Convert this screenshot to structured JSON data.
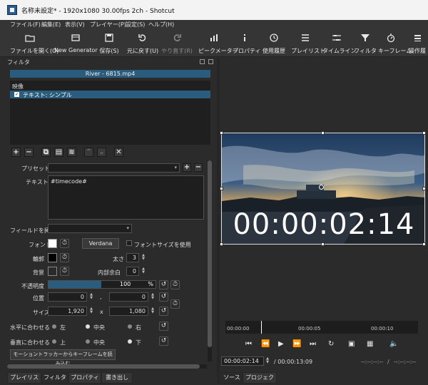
{
  "window": {
    "title": "名称未設定* - 1920x1080 30.00fps 2ch - Shotcut"
  },
  "menu": [
    "ファイル(F)",
    "編集(E)",
    "表示(V)",
    "プレイヤー(P)",
    "設定(S)",
    "ヘルプ(H)"
  ],
  "toolbar": [
    {
      "label": "ファイルを開く(O)",
      "icon": "folder-icon"
    },
    {
      "label": "New Generator",
      "icon": "film-icon"
    },
    {
      "label": "保存(S)",
      "icon": "save-icon"
    },
    {
      "label": "元に戻す(U)",
      "icon": "undo-icon"
    },
    {
      "label": "やり直す(R)",
      "icon": "redo-icon"
    },
    {
      "label": "ピークメーター",
      "icon": "meter-icon"
    },
    {
      "label": "プロパティ",
      "icon": "info-icon"
    },
    {
      "label": "使用履歴",
      "icon": "clock-icon"
    },
    {
      "label": "プレイリスト",
      "icon": "list-icon"
    },
    {
      "label": "タイムライン",
      "icon": "timeline-icon"
    },
    {
      "label": "フィルタ",
      "icon": "funnel-icon"
    },
    {
      "label": "キーフレーム",
      "icon": "stopwatch-icon"
    },
    {
      "label": "操作履",
      "icon": "history-icon"
    }
  ],
  "filters": {
    "panel_title": "フィルタ",
    "clip_name": "River - 6815.mp4",
    "category": "映像",
    "item": "テキスト: シンプル",
    "preset_label": "プリセット",
    "text_label": "テキスト",
    "text_value": "#timecode#",
    "insert_field_label": "フィールドを挿入",
    "font_label": "フォント",
    "font_button": "Verdana",
    "font_size_option": "フォントサイズを使用",
    "outline_label": "輪郭",
    "thickness_label": "太さ",
    "thickness_value": "3",
    "background_label": "背景",
    "padding_label": "内部余白",
    "padding_value": "0",
    "opacity_label": "不透明度",
    "opacity_value": "100",
    "opacity_fraction": 1.0,
    "opacity_unit": "%",
    "position_label": "位置",
    "pos_x": "0",
    "pos_y": "0",
    "comma": ",",
    "size_label": "サイズ",
    "size_w": "1,920",
    "size_h": "1,080",
    "times": "x",
    "halign_label": "水平に合わせる",
    "halign": [
      "左",
      "中央",
      "右"
    ],
    "valign_label": "垂直に合わせる",
    "valign": [
      "上",
      "中央",
      "下"
    ],
    "tracker_button": "モーショントラッカーからキーフレームを読み込む"
  },
  "bottom_tabs_left": [
    "プレイリスト",
    "フィルタ",
    "プロパティ",
    "書き出し"
  ],
  "bottom_tabs_right": [
    "ソース",
    "プロジェクト"
  ],
  "preview": {
    "timecode_overlay": "00:00:02:14",
    "ruler": [
      "00:00:00",
      "00:00:05",
      "00:00:10"
    ],
    "current_time": "00:00:02:14",
    "total_time": "/ 00:00:13:09",
    "in_point": "--:--:--:--",
    "out_point": "--:--:--:--",
    "separator": "/"
  }
}
